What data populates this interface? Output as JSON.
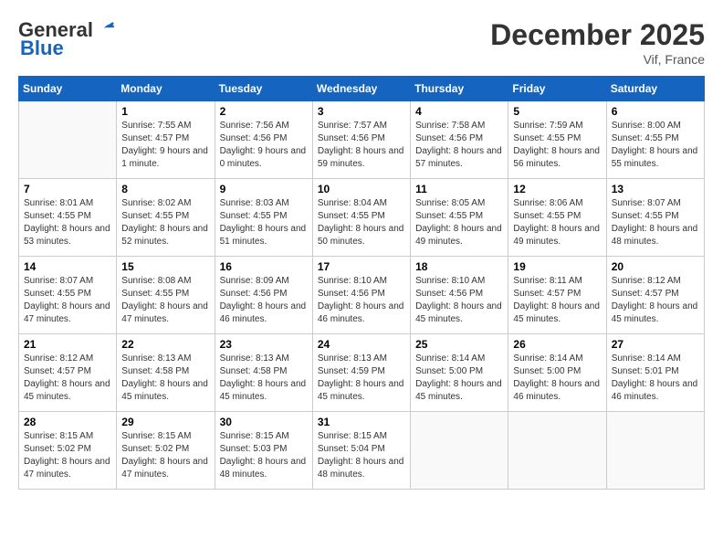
{
  "header": {
    "logo_general": "General",
    "logo_blue": "Blue",
    "month_title": "December 2025",
    "subtitle": "Vif, France"
  },
  "days_of_week": [
    "Sunday",
    "Monday",
    "Tuesday",
    "Wednesday",
    "Thursday",
    "Friday",
    "Saturday"
  ],
  "weeks": [
    [
      {
        "day": "",
        "sunrise": "",
        "sunset": "",
        "daylight": ""
      },
      {
        "day": "1",
        "sunrise": "Sunrise: 7:55 AM",
        "sunset": "Sunset: 4:57 PM",
        "daylight": "Daylight: 9 hours and 1 minute."
      },
      {
        "day": "2",
        "sunrise": "Sunrise: 7:56 AM",
        "sunset": "Sunset: 4:56 PM",
        "daylight": "Daylight: 9 hours and 0 minutes."
      },
      {
        "day": "3",
        "sunrise": "Sunrise: 7:57 AM",
        "sunset": "Sunset: 4:56 PM",
        "daylight": "Daylight: 8 hours and 59 minutes."
      },
      {
        "day": "4",
        "sunrise": "Sunrise: 7:58 AM",
        "sunset": "Sunset: 4:56 PM",
        "daylight": "Daylight: 8 hours and 57 minutes."
      },
      {
        "day": "5",
        "sunrise": "Sunrise: 7:59 AM",
        "sunset": "Sunset: 4:55 PM",
        "daylight": "Daylight: 8 hours and 56 minutes."
      },
      {
        "day": "6",
        "sunrise": "Sunrise: 8:00 AM",
        "sunset": "Sunset: 4:55 PM",
        "daylight": "Daylight: 8 hours and 55 minutes."
      }
    ],
    [
      {
        "day": "7",
        "sunrise": "Sunrise: 8:01 AM",
        "sunset": "Sunset: 4:55 PM",
        "daylight": "Daylight: 8 hours and 53 minutes."
      },
      {
        "day": "8",
        "sunrise": "Sunrise: 8:02 AM",
        "sunset": "Sunset: 4:55 PM",
        "daylight": "Daylight: 8 hours and 52 minutes."
      },
      {
        "day": "9",
        "sunrise": "Sunrise: 8:03 AM",
        "sunset": "Sunset: 4:55 PM",
        "daylight": "Daylight: 8 hours and 51 minutes."
      },
      {
        "day": "10",
        "sunrise": "Sunrise: 8:04 AM",
        "sunset": "Sunset: 4:55 PM",
        "daylight": "Daylight: 8 hours and 50 minutes."
      },
      {
        "day": "11",
        "sunrise": "Sunrise: 8:05 AM",
        "sunset": "Sunset: 4:55 PM",
        "daylight": "Daylight: 8 hours and 49 minutes."
      },
      {
        "day": "12",
        "sunrise": "Sunrise: 8:06 AM",
        "sunset": "Sunset: 4:55 PM",
        "daylight": "Daylight: 8 hours and 49 minutes."
      },
      {
        "day": "13",
        "sunrise": "Sunrise: 8:07 AM",
        "sunset": "Sunset: 4:55 PM",
        "daylight": "Daylight: 8 hours and 48 minutes."
      }
    ],
    [
      {
        "day": "14",
        "sunrise": "Sunrise: 8:07 AM",
        "sunset": "Sunset: 4:55 PM",
        "daylight": "Daylight: 8 hours and 47 minutes."
      },
      {
        "day": "15",
        "sunrise": "Sunrise: 8:08 AM",
        "sunset": "Sunset: 4:55 PM",
        "daylight": "Daylight: 8 hours and 47 minutes."
      },
      {
        "day": "16",
        "sunrise": "Sunrise: 8:09 AM",
        "sunset": "Sunset: 4:56 PM",
        "daylight": "Daylight: 8 hours and 46 minutes."
      },
      {
        "day": "17",
        "sunrise": "Sunrise: 8:10 AM",
        "sunset": "Sunset: 4:56 PM",
        "daylight": "Daylight: 8 hours and 46 minutes."
      },
      {
        "day": "18",
        "sunrise": "Sunrise: 8:10 AM",
        "sunset": "Sunset: 4:56 PM",
        "daylight": "Daylight: 8 hours and 45 minutes."
      },
      {
        "day": "19",
        "sunrise": "Sunrise: 8:11 AM",
        "sunset": "Sunset: 4:57 PM",
        "daylight": "Daylight: 8 hours and 45 minutes."
      },
      {
        "day": "20",
        "sunrise": "Sunrise: 8:12 AM",
        "sunset": "Sunset: 4:57 PM",
        "daylight": "Daylight: 8 hours and 45 minutes."
      }
    ],
    [
      {
        "day": "21",
        "sunrise": "Sunrise: 8:12 AM",
        "sunset": "Sunset: 4:57 PM",
        "daylight": "Daylight: 8 hours and 45 minutes."
      },
      {
        "day": "22",
        "sunrise": "Sunrise: 8:13 AM",
        "sunset": "Sunset: 4:58 PM",
        "daylight": "Daylight: 8 hours and 45 minutes."
      },
      {
        "day": "23",
        "sunrise": "Sunrise: 8:13 AM",
        "sunset": "Sunset: 4:58 PM",
        "daylight": "Daylight: 8 hours and 45 minutes."
      },
      {
        "day": "24",
        "sunrise": "Sunrise: 8:13 AM",
        "sunset": "Sunset: 4:59 PM",
        "daylight": "Daylight: 8 hours and 45 minutes."
      },
      {
        "day": "25",
        "sunrise": "Sunrise: 8:14 AM",
        "sunset": "Sunset: 5:00 PM",
        "daylight": "Daylight: 8 hours and 45 minutes."
      },
      {
        "day": "26",
        "sunrise": "Sunrise: 8:14 AM",
        "sunset": "Sunset: 5:00 PM",
        "daylight": "Daylight: 8 hours and 46 minutes."
      },
      {
        "day": "27",
        "sunrise": "Sunrise: 8:14 AM",
        "sunset": "Sunset: 5:01 PM",
        "daylight": "Daylight: 8 hours and 46 minutes."
      }
    ],
    [
      {
        "day": "28",
        "sunrise": "Sunrise: 8:15 AM",
        "sunset": "Sunset: 5:02 PM",
        "daylight": "Daylight: 8 hours and 47 minutes."
      },
      {
        "day": "29",
        "sunrise": "Sunrise: 8:15 AM",
        "sunset": "Sunset: 5:02 PM",
        "daylight": "Daylight: 8 hours and 47 minutes."
      },
      {
        "day": "30",
        "sunrise": "Sunrise: 8:15 AM",
        "sunset": "Sunset: 5:03 PM",
        "daylight": "Daylight: 8 hours and 48 minutes."
      },
      {
        "day": "31",
        "sunrise": "Sunrise: 8:15 AM",
        "sunset": "Sunset: 5:04 PM",
        "daylight": "Daylight: 8 hours and 48 minutes."
      },
      {
        "day": "",
        "sunrise": "",
        "sunset": "",
        "daylight": ""
      },
      {
        "day": "",
        "sunrise": "",
        "sunset": "",
        "daylight": ""
      },
      {
        "day": "",
        "sunrise": "",
        "sunset": "",
        "daylight": ""
      }
    ]
  ]
}
